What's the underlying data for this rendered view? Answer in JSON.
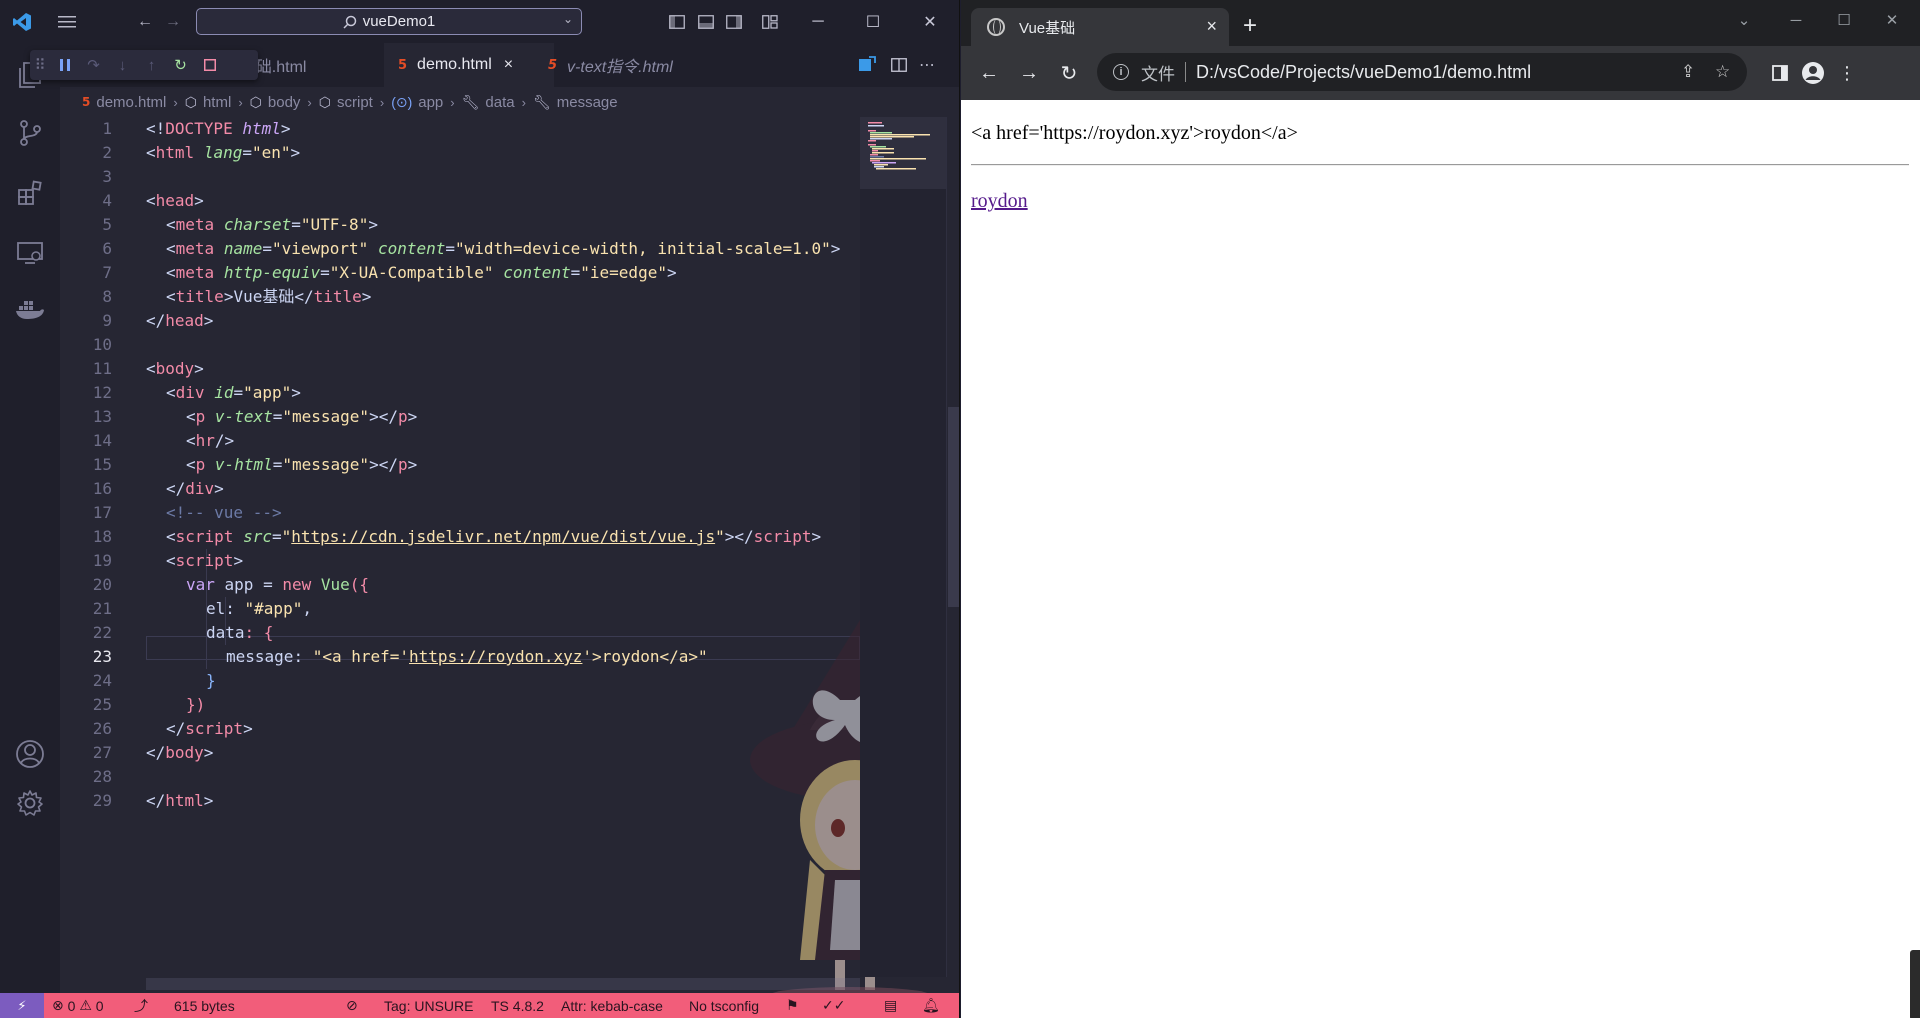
{
  "vscode": {
    "command_center": "vueDemo1",
    "tabs": [
      {
        "label": "vue基础.html",
        "italic": false
      },
      {
        "label": "demo.html",
        "italic": false
      },
      {
        "label": "v-text指令.html",
        "italic": true
      }
    ],
    "tab_close_glyph": "×",
    "breadcrumbs": [
      "demo.html",
      "html",
      "body",
      "script",
      "app",
      "data",
      "message"
    ],
    "html5_glyph": "5",
    "line_numbers": [
      "1",
      "2",
      "3",
      "4",
      "5",
      "6",
      "7",
      "8",
      "9",
      "10",
      "11",
      "12",
      "13",
      "14",
      "15",
      "16",
      "17",
      "18",
      "19",
      "20",
      "21",
      "22",
      "23",
      "24",
      "25",
      "26",
      "27",
      "28",
      "29"
    ],
    "current_line": 23,
    "code": {
      "l1": [
        "<!",
        "DOCTYPE",
        " ",
        "html",
        ">"
      ],
      "l2": [
        "<",
        "html",
        " ",
        "lang",
        "=",
        "\"en\"",
        ">"
      ],
      "l4": [
        "<",
        "head",
        ">"
      ],
      "l5": [
        "<",
        "meta",
        " ",
        "charset",
        "=",
        "\"UTF-8\"",
        ">"
      ],
      "l6": [
        "<",
        "meta",
        " ",
        "name",
        "=",
        "\"viewport\"",
        " ",
        "content",
        "=",
        "\"width=device-width, initial-scale=1.0\"",
        ">"
      ],
      "l7": [
        "<",
        "meta",
        " ",
        "http-equiv",
        "=",
        "\"X-UA-Compatible\"",
        " ",
        "content",
        "=",
        "\"ie=edge\"",
        ">"
      ],
      "l8": [
        "<",
        "title",
        ">",
        "Vue基础",
        "</",
        "title",
        ">"
      ],
      "l9": [
        "</",
        "head",
        ">"
      ],
      "l11": [
        "<",
        "body",
        ">"
      ],
      "l12": [
        "<",
        "div",
        " ",
        "id",
        "=",
        "\"app\"",
        ">"
      ],
      "l13": [
        "<",
        "p",
        " ",
        "v-text",
        "=",
        "\"message\"",
        "></",
        "p",
        ">"
      ],
      "l14": [
        "<",
        "hr",
        "/>"
      ],
      "l15": [
        "<",
        "p",
        " ",
        "v-html",
        "=",
        "\"message\"",
        "></",
        "p",
        ">"
      ],
      "l16": [
        "</",
        "div",
        ">"
      ],
      "l17": "<!-- vue -->",
      "l18": [
        "<",
        "script",
        " ",
        "src",
        "=",
        "\"",
        "https://cdn.jsdelivr.net/npm/vue/dist/vue.js",
        "\"",
        "></",
        "script",
        ">"
      ],
      "l19": [
        "<",
        "script",
        ">"
      ],
      "l20": [
        "var",
        " app = ",
        "new",
        " ",
        "Vue",
        "({"
      ],
      "l21": [
        "el",
        ": ",
        "\"#app\"",
        ","
      ],
      "l22": [
        "data",
        ": {"
      ],
      "l23": [
        "message",
        ": ",
        "\"<a href='",
        "https://roydon.xyz",
        "'>roydon</a>\""
      ],
      "l24": "}",
      "l25": "})",
      "l26": [
        "</",
        "script",
        ">"
      ],
      "l27": [
        "</",
        "body",
        ">"
      ],
      "l29": [
        "</",
        "html",
        ">"
      ]
    },
    "status": {
      "errors": "0",
      "warnings": "0",
      "size": "615 bytes",
      "tag": "Tag: UNSURE",
      "ts": "TS 4.8.2",
      "attr": "Attr: kebab-case",
      "tsconfig": "No tsconfig"
    }
  },
  "browser": {
    "tab_title": "Vue基础",
    "tab_close_glyph": "×",
    "new_tab_glyph": "+",
    "address_prefix": "文件",
    "address_info_glyph": "i",
    "address_url": "D:/vsCode/Projects/vueDemo1/demo.html",
    "page": {
      "v_text_output": "<a href='https://roydon.xyz'>roydon</a>",
      "v_html_link": "roydon"
    }
  },
  "colors": {
    "statusbar": "#f25d7a",
    "editor_bg": "#262633",
    "tag": "#f38ba8",
    "attr": "#a6e3a1",
    "string": "#f9e2af",
    "link_visited": "#551a8b"
  }
}
